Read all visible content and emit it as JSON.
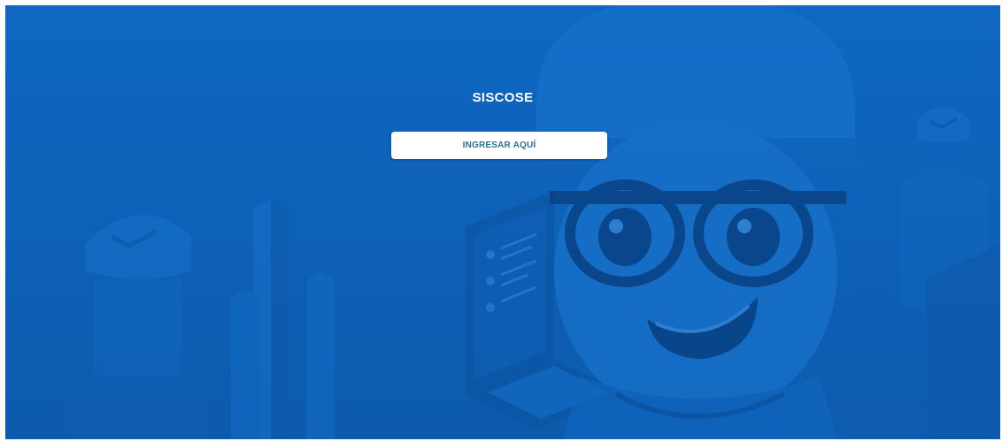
{
  "app": {
    "title": "SISCOSE"
  },
  "login": {
    "button_label": "INGRESAR AQUÍ"
  },
  "colors": {
    "background": "#0e64bd",
    "button_background": "#ffffff",
    "button_text": "#2e6f94",
    "title_text": "#ffffff"
  }
}
